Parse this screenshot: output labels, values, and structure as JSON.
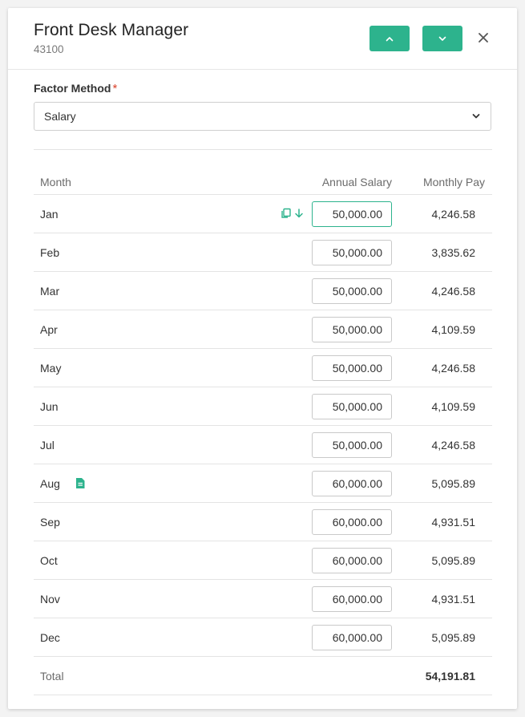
{
  "header": {
    "title": "Front Desk Manager",
    "subtitle": "43100",
    "prev_icon": "chevron-up-icon",
    "next_icon": "chevron-down-icon",
    "close_icon": "close-icon"
  },
  "factor": {
    "label": "Factor Method",
    "required_mark": "*",
    "value": "Salary"
  },
  "table": {
    "columns": {
      "month": "Month",
      "salary": "Annual Salary",
      "pay": "Monthly Pay"
    },
    "rows": [
      {
        "month": "Jan",
        "salary": "50,000.00",
        "pay": "4,246.58",
        "icons": [
          "copy-icon",
          "arrow-down-icon"
        ]
      },
      {
        "month": "Feb",
        "salary": "50,000.00",
        "pay": "3,835.62"
      },
      {
        "month": "Mar",
        "salary": "50,000.00",
        "pay": "4,246.58"
      },
      {
        "month": "Apr",
        "salary": "50,000.00",
        "pay": "4,109.59"
      },
      {
        "month": "May",
        "salary": "50,000.00",
        "pay": "4,246.58"
      },
      {
        "month": "Jun",
        "salary": "50,000.00",
        "pay": "4,109.59"
      },
      {
        "month": "Jul",
        "salary": "50,000.00",
        "pay": "4,246.58"
      },
      {
        "month": "Aug",
        "salary": "60,000.00",
        "pay": "5,095.89",
        "icons": [
          "note-icon"
        ]
      },
      {
        "month": "Sep",
        "salary": "60,000.00",
        "pay": "4,931.51"
      },
      {
        "month": "Oct",
        "salary": "60,000.00",
        "pay": "5,095.89"
      },
      {
        "month": "Nov",
        "salary": "60,000.00",
        "pay": "4,931.51"
      },
      {
        "month": "Dec",
        "salary": "60,000.00",
        "pay": "5,095.89"
      }
    ],
    "total": {
      "label": "Total",
      "value": "54,191.81"
    }
  },
  "colors": {
    "accent": "#2db38d",
    "required": "#d9422b",
    "border": "#e4e4e4"
  }
}
